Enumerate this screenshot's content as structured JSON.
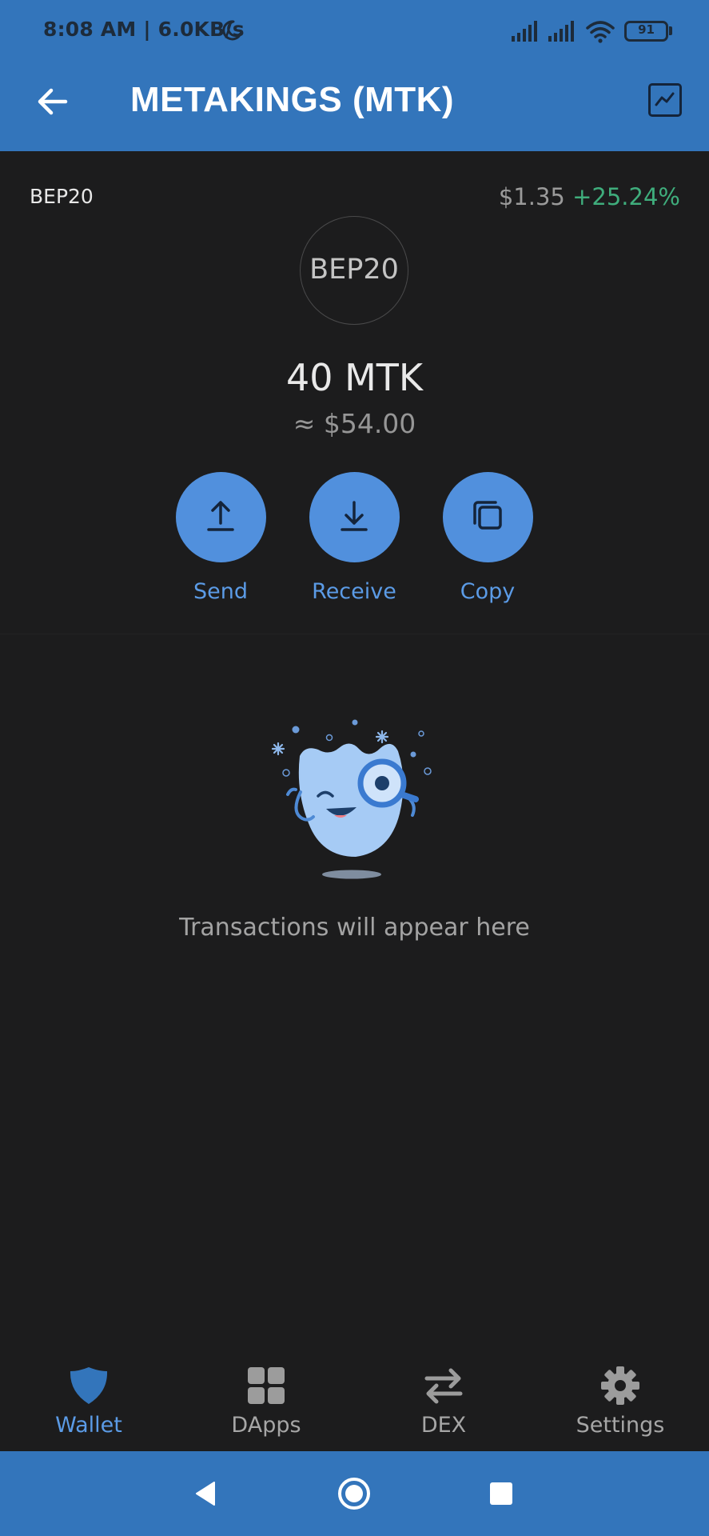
{
  "status_bar": {
    "time_speed": "8:08 AM | 6.0KB/s",
    "battery": "91"
  },
  "app_bar": {
    "title": "METAKINGS (MTK)",
    "back_icon": "arrow-left-icon",
    "chart_icon": "chart-line-icon"
  },
  "token": {
    "network": "BEP20",
    "price": "$1.35",
    "change": "+25.24%",
    "logo_text": "BEP20",
    "balance": "40 MTK",
    "fiat_value": "≈ $54.00"
  },
  "actions": [
    {
      "label": "Send",
      "icon": "upload-arrow-icon"
    },
    {
      "label": "Receive",
      "icon": "download-arrow-icon"
    },
    {
      "label": "Copy",
      "icon": "copy-icon"
    }
  ],
  "empty_state": {
    "message": "Transactions will appear here",
    "illustration": "winking-mascot-magnifier"
  },
  "bottom_nav": [
    {
      "label": "Wallet",
      "icon": "shield-icon",
      "active": true
    },
    {
      "label": "DApps",
      "icon": "grid-icon",
      "active": false
    },
    {
      "label": "DEX",
      "icon": "swap-arrows-icon",
      "active": false
    },
    {
      "label": "Settings",
      "icon": "gear-icon",
      "active": false
    }
  ],
  "colors": {
    "primary": "#3375bb",
    "accent": "#5b9be6",
    "positive": "#3fad7c",
    "background": "#1c1c1d"
  }
}
